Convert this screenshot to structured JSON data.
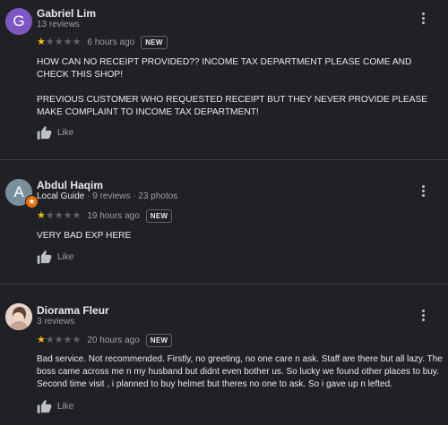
{
  "reviews": [
    {
      "avatar_letter": "G",
      "avatar_color": "#7e57c2",
      "name": "Gabriel Lim",
      "meta": "13 reviews",
      "stars": 1,
      "time": "6 hours ago",
      "badge": "NEW",
      "text": "HOW CAN NO RECEIPT PROVIDED?? INCOME TAX DEPARTMENT PLEASE COME AND CHECK THIS SHOP!\n\nPREVIOUS CUSTOMER WHO REQUESTED RECEIPT BUT THEY NEVER PROVIDE PLEASE MAKE COMPLAINT TO INCOME TAX DEPARTMENT!",
      "like_label": "Like"
    },
    {
      "avatar_letter": "A",
      "avatar_color": "#78909c",
      "name": "Abdul Haqim",
      "guide_label": "Local Guide",
      "meta": " · 9 reviews · 23 photos",
      "stars": 1,
      "time": "19 hours ago",
      "badge": "NEW",
      "text": "VERY BAD EXP HERE",
      "like_label": "Like"
    },
    {
      "avatar_letter": "",
      "name": "Diorama Fleur",
      "meta": "3 reviews",
      "stars": 1,
      "time": "20 hours ago",
      "badge": "NEW",
      "text": "Bad service. Not recommended. Firstly, no greeting, no one care n ask. Staff are there but all lazy. The boss came across me n my husband but didnt even bother us. So lucky we found other places to buy. Second time visit , i planned to buy helmet but theres no one to ask. So i gave up n lefted.",
      "like_label": "Like"
    }
  ],
  "star_max": 5,
  "colors": {
    "background": "#202124",
    "star_filled": "#fbbc04",
    "star_empty": "#5f6368",
    "local_guide_badge": "#e8710a"
  },
  "icons": {
    "menu": "more-vert-icon",
    "like": "thumb-up-icon",
    "guide": "local-guide-star-icon"
  }
}
